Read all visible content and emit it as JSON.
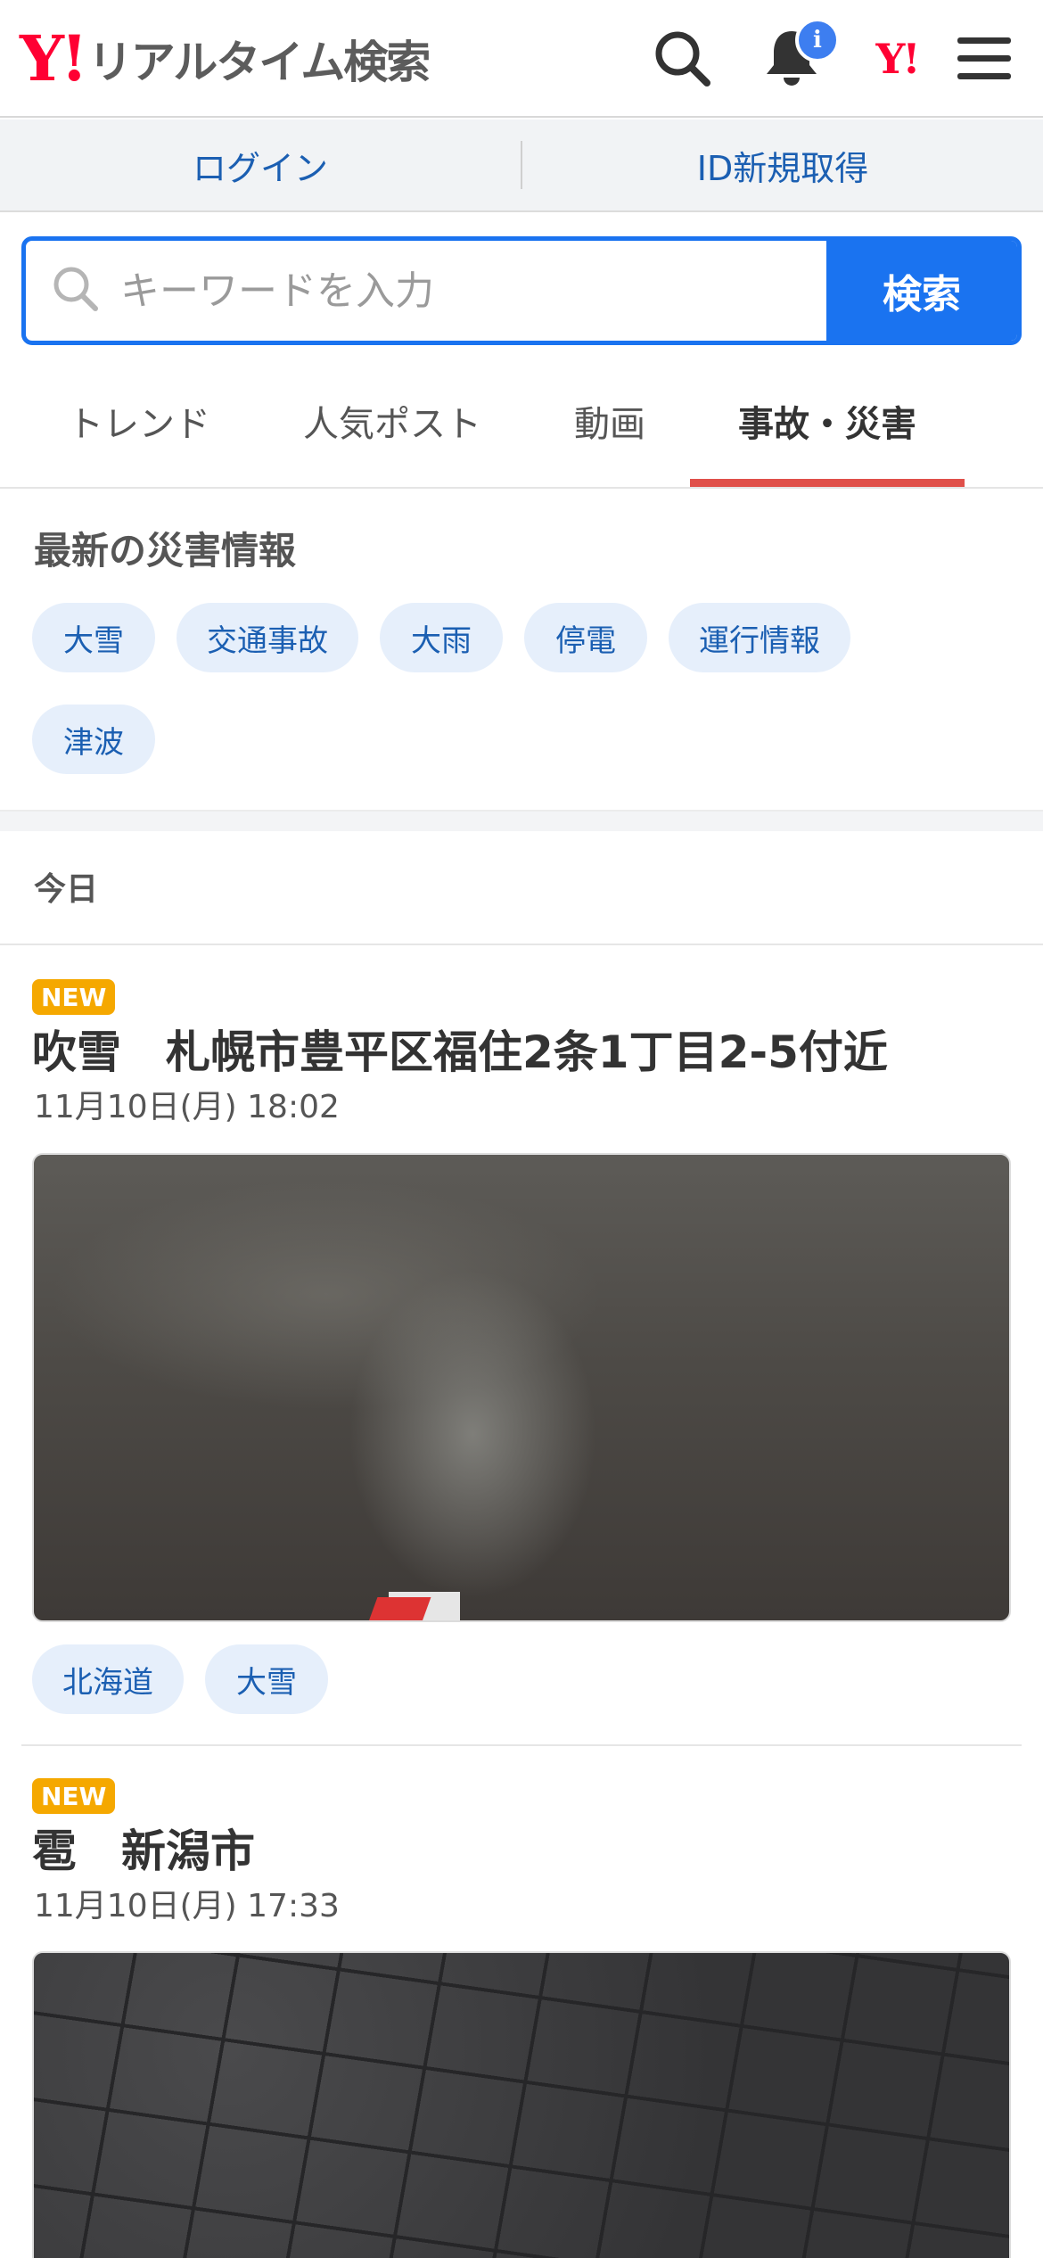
{
  "header": {
    "logo_mark": "Y!",
    "logo_text": "リアルタイム検索",
    "notification_badge": "i",
    "yahoo_mark": "Y!"
  },
  "account": {
    "login": "ログイン",
    "signup": "ID新規取得"
  },
  "search": {
    "placeholder": "キーワードを入力",
    "button": "検索"
  },
  "tabs": [
    {
      "label": "トレンド",
      "active": false
    },
    {
      "label": "人気ポスト",
      "active": false
    },
    {
      "label": "動画",
      "active": false
    },
    {
      "label": "事故・災害",
      "active": true
    }
  ],
  "disaster": {
    "title": "最新の災害情報",
    "chips": [
      "大雪",
      "交通事故",
      "大雨",
      "停電",
      "運行情報",
      "津波"
    ]
  },
  "section_label": "今日",
  "posts": [
    {
      "badge": "NEW",
      "title": "吹雪　札幌市豊平区福住2条1丁目2-5付近",
      "date": "11月10日(月) 18:02",
      "tags": [
        "北海道",
        "大雪"
      ]
    },
    {
      "badge": "NEW",
      "title": "雹　新潟市",
      "date": "11月10日(月) 17:33",
      "tags": []
    }
  ],
  "colors": {
    "brand_red": "#ff0033",
    "accent_blue": "#1a73f0",
    "active_tab_underline": "#e0504a",
    "new_badge": "#f5a800",
    "chip_bg": "#e6effb"
  }
}
